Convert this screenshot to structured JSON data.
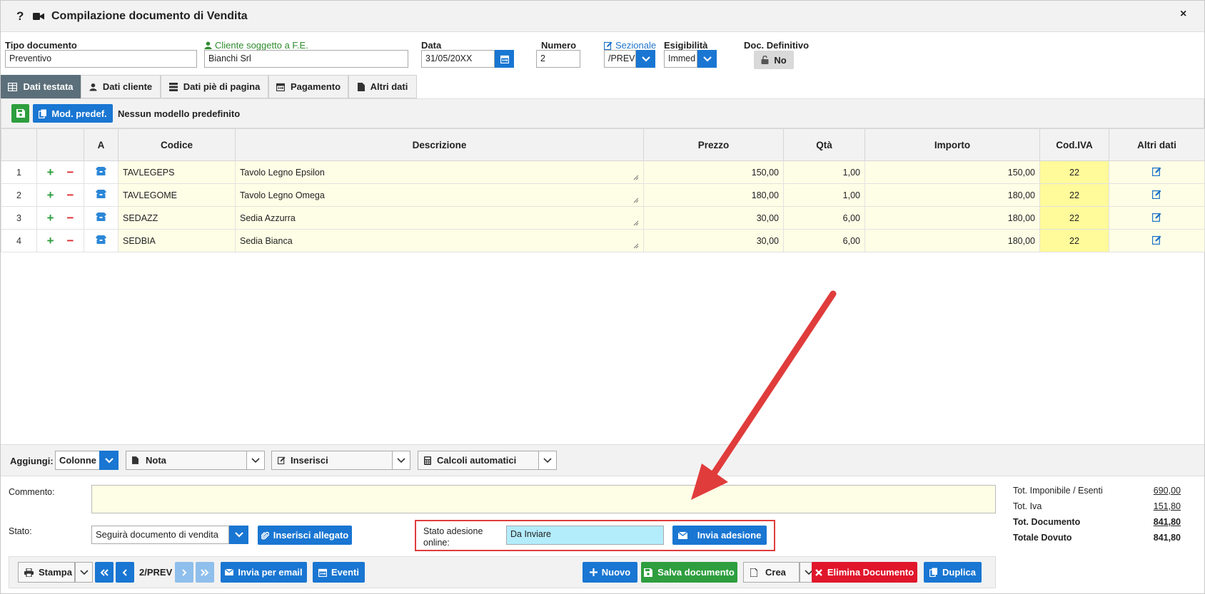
{
  "window": {
    "help_label": "?",
    "title": "Compilazione documento di Vendita",
    "close_label": "×"
  },
  "header": {
    "tipo_label": "Tipo documento",
    "tipo_value": "Preventivo",
    "cliente_label": "Cliente soggetto a F.E.",
    "cliente_value": "Bianchi Srl",
    "data_label": "Data",
    "data_value": "31/05/20XX",
    "numero_label": "Numero",
    "numero_value": "2",
    "sezionale_label": "Sezionale",
    "sezionale_value": "/PREV",
    "esigibilita_label": "Esigibilità",
    "esigibilita_value": "Immed",
    "definitivo_label": "Doc. Definitivo",
    "definitivo_value": "No"
  },
  "tabs": [
    {
      "label": "Dati testata",
      "icon": "table-icon"
    },
    {
      "label": "Dati cliente",
      "icon": "user-icon"
    },
    {
      "label": "Dati piè di pagina",
      "icon": "server-icon"
    },
    {
      "label": "Pagamento",
      "icon": "calendar-icon"
    },
    {
      "label": "Altri dati",
      "icon": "file-icon"
    }
  ],
  "toolbar": {
    "mod_label": "Mod. predef.",
    "modello_text": "Nessun modello predefinito"
  },
  "table": {
    "columns": [
      "",
      "",
      "A",
      "Codice",
      "Descrizione",
      "Prezzo",
      "Qtà",
      "Importo",
      "Cod.IVA",
      "Altri dati"
    ],
    "rows": [
      {
        "n": "1",
        "codice": "TAVLEGEPS",
        "descrizione": "Tavolo Legno Epsilon",
        "prezzo": "150,00",
        "qta": "1,00",
        "importo": "150,00",
        "iva": "22"
      },
      {
        "n": "2",
        "codice": "TAVLEGOME",
        "descrizione": "Tavolo Legno Omega",
        "prezzo": "180,00",
        "qta": "1,00",
        "importo": "180,00",
        "iva": "22"
      },
      {
        "n": "3",
        "codice": "SEDAZZ",
        "descrizione": "Sedia Azzurra",
        "prezzo": "30,00",
        "qta": "6,00",
        "importo": "180,00",
        "iva": "22"
      },
      {
        "n": "4",
        "codice": "SEDBIA",
        "descrizione": "Sedia Bianca",
        "prezzo": "30,00",
        "qta": "6,00",
        "importo": "180,00",
        "iva": "22"
      }
    ]
  },
  "addbar": {
    "aggiungi_label": "Aggiungi:",
    "colonne_label": "Colonne",
    "nota_label": "Nota",
    "inserisci_label": "Inserisci",
    "calcoli_label": "Calcoli automatici"
  },
  "footer": {
    "commento_label": "Commento:",
    "stato_label": "Stato:",
    "stato_value": "Seguirà documento di vendita",
    "allegato_label": "Inserisci allegato",
    "adesione_label_1": "Stato adesione",
    "adesione_label_2": "online:",
    "adesione_value": "Da Inviare",
    "invia_adesione_label": "Invia adesione"
  },
  "totals": [
    {
      "label": "Tot. Imponibile / Esenti",
      "value": "690,00",
      "bold": false
    },
    {
      "label": "Tot. Iva",
      "value": "151,80",
      "bold": false
    },
    {
      "label": "Tot. Documento",
      "value": "841,80",
      "bold": true
    },
    {
      "label": "Totale Dovuto",
      "value": "841,80",
      "bold": true
    }
  ],
  "bottombar": {
    "stampa_label": "Stampa",
    "nav_text": "2/PREV",
    "email_label": "Invia per email",
    "eventi_label": "Eventi",
    "nuovo_label": "Nuovo",
    "salva_label": "Salva documento",
    "crea_label": "Crea",
    "elimina_label": "Elimina Documento",
    "duplica_label": "Duplica"
  },
  "colors": {
    "primary": "#1976d2",
    "success": "#2e9e3e",
    "danger": "#e0162b",
    "annotation": "#e03c3c",
    "row_bg": "#fefee6",
    "iva_bg": "#fffa9a",
    "active_tab": "#5b6f7a",
    "adesione_bg": "#b3ecfb"
  }
}
